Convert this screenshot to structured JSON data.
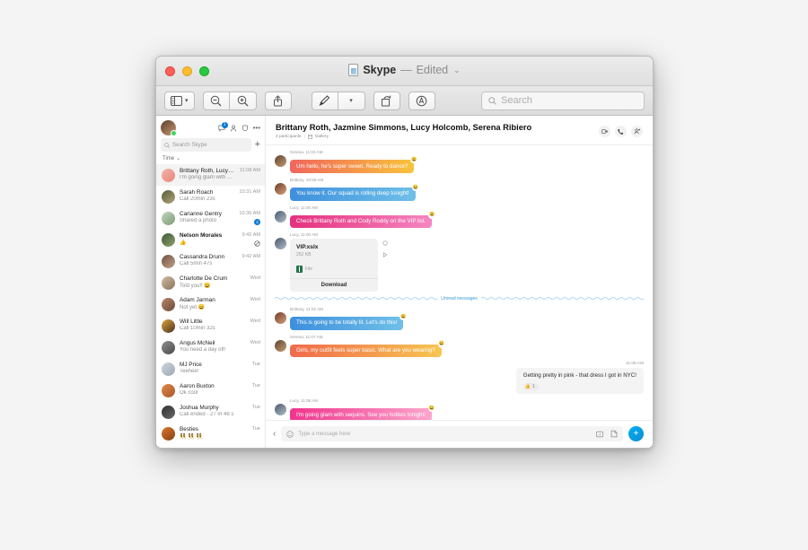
{
  "window": {
    "title_name": "Skype",
    "title_dash": "—",
    "title_edited": "Edited",
    "title_chevron": "⌄"
  },
  "toolbar": {
    "sidebar_view_label": "sidebar-view",
    "zoom_out_label": "zoom-out",
    "zoom_in_label": "zoom-in",
    "share_label": "share",
    "markup_label": "markup",
    "rotate_label": "rotate",
    "annotate_label": "annotate",
    "search_placeholder": "Search"
  },
  "sidebar": {
    "search_placeholder": "Search Skype",
    "add_label": "+",
    "filter_label": "Time",
    "filter_chevron": "⌄",
    "icons": [
      "chat-badge-icon",
      "add-contact-icon",
      "meet-now-icon",
      "more-options-icon"
    ],
    "badge_count": "1",
    "chats": [
      {
        "name": "Brittany Roth, Lucy Hol…",
        "msg": "I'm going glam with sequins.",
        "time": "11:08 AM",
        "active": true,
        "bold": false,
        "online": false,
        "badge": "",
        "mute": false,
        "av1": "#f3b3a8",
        "av2": "#e8857a"
      },
      {
        "name": "Sarah Roach",
        "msg": "Call 20min 23s",
        "time": "10:31 AM",
        "active": false,
        "bold": false,
        "online": true,
        "badge": "",
        "mute": false,
        "av1": "#4f5d3a",
        "av2": "#b9a37c"
      },
      {
        "name": "Carianne Gentry",
        "msg": "Shared a photo",
        "time": "10:30 AM",
        "active": false,
        "bold": false,
        "online": true,
        "badge": "3",
        "mute": false,
        "av1": "#c3d6c0",
        "av2": "#7d9b74"
      },
      {
        "name": "Nelson Morales",
        "msg": "👍",
        "time": "9:42 AM",
        "active": false,
        "bold": true,
        "online": false,
        "badge": "",
        "mute": true,
        "av1": "#3b5a3a",
        "av2": "#8fa26a"
      },
      {
        "name": "Cassandra Drunn",
        "msg": "Call 5min 47s",
        "time": "9:42 AM",
        "active": false,
        "bold": false,
        "online": false,
        "badge": "",
        "mute": false,
        "av1": "#6f5242",
        "av2": "#c3a08a"
      },
      {
        "name": "Charlotte De Crum",
        "msg": "Told you!! 😄",
        "time": "Wed",
        "active": false,
        "bold": false,
        "online": true,
        "badge": "",
        "mute": false,
        "av1": "#cdbba2",
        "av2": "#8a7458"
      },
      {
        "name": "Adam Jarman",
        "msg": "Not yet 😄",
        "time": "Wed",
        "active": false,
        "bold": false,
        "online": false,
        "badge": "",
        "mute": false,
        "av1": "#b8866a",
        "av2": "#6d4a38"
      },
      {
        "name": "Will Little",
        "msg": "Call 10min 32s",
        "time": "Wed",
        "active": false,
        "bold": false,
        "online": false,
        "badge": "",
        "mute": false,
        "av1": "#e0a33c",
        "av2": "#4a3320"
      },
      {
        "name": "Angus McNeil",
        "msg": "You need a day off!",
        "time": "Wed",
        "active": false,
        "bold": false,
        "online": false,
        "badge": "",
        "mute": false,
        "av1": "#8f8f8f",
        "av2": "#4a4a4a"
      },
      {
        "name": "MJ Price",
        "msg": "Teehee!",
        "time": "Tue",
        "active": false,
        "bold": false,
        "online": false,
        "badge": "",
        "mute": false,
        "av1": "#cfd6dd",
        "av2": "#9aa7b4"
      },
      {
        "name": "Aaron Buxton",
        "msg": "Ok cool",
        "time": "Tue",
        "active": false,
        "bold": false,
        "online": false,
        "badge": "",
        "mute": false,
        "av1": "#e08a4a",
        "av2": "#a8572a"
      },
      {
        "name": "Joshua Murphy",
        "msg": "Call ended - 27 m 48 s",
        "time": "Tue",
        "active": false,
        "bold": false,
        "online": true,
        "badge": "",
        "mute": false,
        "av1": "#2e2e2e",
        "av2": "#6a6a6a"
      },
      {
        "name": "Besties",
        "msg": "👯 👯 👯",
        "time": "Tue",
        "active": false,
        "bold": false,
        "online": false,
        "badge": "",
        "mute": false,
        "av1": "#d9762a",
        "av2": "#8a3f14"
      }
    ]
  },
  "chat_header": {
    "title": "Brittany Roth, Jazmine Simmons, Lucy Holcomb, Serena Ribiero",
    "participants": "4 participants",
    "separator": "|",
    "gallery": "Gallery",
    "actions": [
      "video-call-icon",
      "audio-call-icon",
      "add-people-icon"
    ]
  },
  "messages": [
    {
      "kind": "in",
      "sender": "Serena",
      "time": "11:02 AM",
      "meta": "Serena, 11:02 AM",
      "text": "Um hello, he's super sweet. Ready to dance?",
      "style": "b-orange",
      "reaction": "😀",
      "av1": "#5a4432",
      "av2": "#c79a6f"
    },
    {
      "kind": "in",
      "sender": "Brittany",
      "time": "10:59 AM",
      "meta": "Brittany, 10:59 AM",
      "text": "You know it. Our squad is rolling deep tonight!",
      "style": "b-blue",
      "reaction": "😀",
      "av1": "#6b3b2a",
      "av2": "#d8a07a"
    },
    {
      "kind": "in",
      "sender": "Lucy",
      "time": "11:00 AM",
      "meta": "Lucy, 11:00 AM",
      "text": "Check Brittany Roth and Cody Roddy on the VIP list.",
      "style": "b-pink",
      "reaction": "😀",
      "av1": "#4a5a6b",
      "av2": "#b0bcc8"
    },
    {
      "kind": "file",
      "sender": "Lucy",
      "time": "11:00 AM",
      "meta": "Lucy, 11:00 AM",
      "file_name": "VIP.xslx",
      "file_size": "252 KB",
      "file_type": "File",
      "download_label": "Download",
      "av1": "#4a5a6b",
      "av2": "#b0bcc8"
    },
    {
      "kind": "separator",
      "label": "Unread messages"
    },
    {
      "kind": "in",
      "sender": "Brittany",
      "time": "11:02 AM",
      "meta": "Brittany, 11:02 AM",
      "text": "This is going to be totally lit. Let's do this!",
      "style": "b-blue",
      "reaction": "😀",
      "av1": "#6b3b2a",
      "av2": "#d8a07a"
    },
    {
      "kind": "in",
      "sender": "Serena",
      "time": "11:07 AM",
      "meta": "Serena, 11:07 AM",
      "text": "Girls, my outfit feels super basic. What are you wearing?",
      "style": "b-orange2",
      "reaction": "😀",
      "av1": "#5a4432",
      "av2": "#c79a6f"
    },
    {
      "kind": "out",
      "time": "11:08 AM",
      "text": "Getting pretty in pink - that dress I got in NYC!",
      "reaction_emoji": "👍",
      "reaction_count": "1"
    },
    {
      "kind": "in",
      "sender": "Lucy",
      "time": "11:08 AM",
      "meta": "Lucy, 11:08 AM",
      "text": "I'm going glam with sequins. See you hotties tonight!",
      "style": "b-pink2",
      "reaction": "😀",
      "av1": "#4a5a6b",
      "av2": "#b0bcc8"
    }
  ],
  "composer": {
    "back_label": "‹",
    "placeholder": "Type a message here",
    "emoji_icon": "emoji-icon",
    "gif_icon": "gif-icon",
    "attach_icon": "attach-icon",
    "send_label": "+"
  }
}
